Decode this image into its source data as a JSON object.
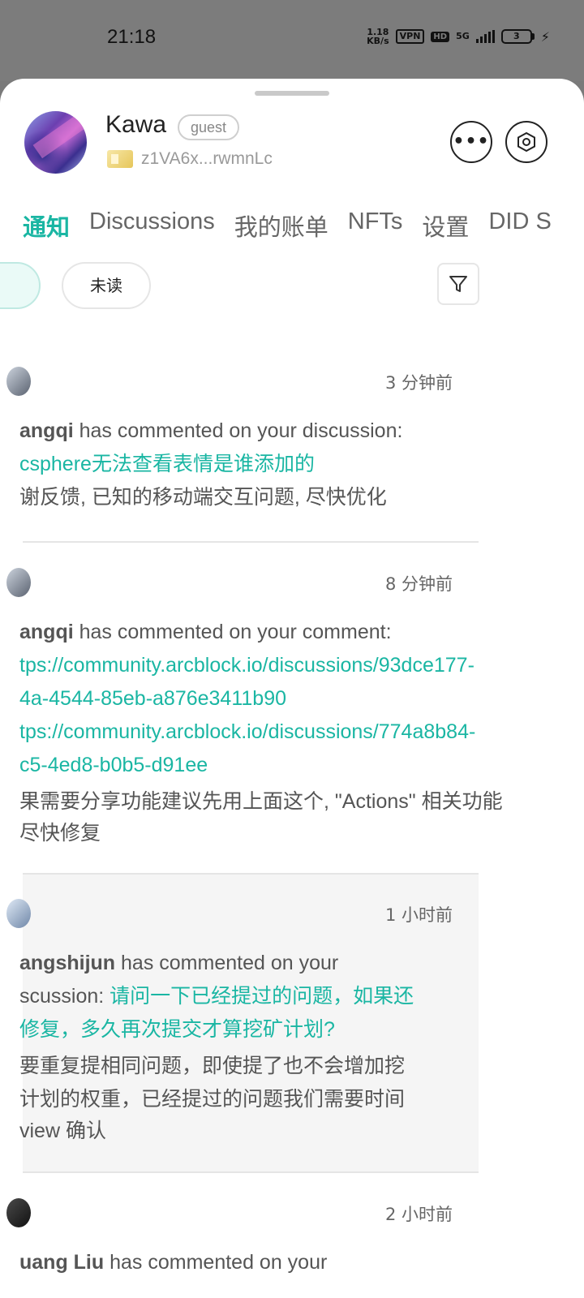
{
  "status_bar": {
    "time": "21:18",
    "net_speed_value": "1.18",
    "net_speed_unit": "KB/s",
    "vpn": "VPN",
    "hd": "HD",
    "network": "5G",
    "battery": "3"
  },
  "profile": {
    "name": "Kawa",
    "role_badge": "guest",
    "did": "z1VA6x...rwmnLc"
  },
  "tabs": [
    "通知",
    "Discussions",
    "我的账单",
    "NFTs",
    "设置",
    "DID S"
  ],
  "filters": {
    "unread_label": "未读"
  },
  "notifications": [
    {
      "time": "3 分钟前",
      "line1_user": "angqi",
      "line1_text": " has commented on your discussion:",
      "line2_link": "csphere无法查看表情是谁添加的",
      "line3": "谢反馈, 已知的移动端交互问题, 尽快优化"
    },
    {
      "time": "8 分钟前",
      "line1_user": "angqi",
      "line1_text": " has commented on your comment:",
      "link1a": "tps://community.arcblock.io/discussions/93dce177-",
      "link1b": "4a-4544-85eb-a876e3411b90",
      "link2a": "tps://community.arcblock.io/discussions/774a8b84-",
      "link2b": "c5-4ed8-b0b5-d91ee",
      "msg1": "果需要分享功能建议先用上面这个, \"Actions\" 相关功能",
      "msg2": "尽快修复"
    },
    {
      "time": "1 小时前",
      "line1_user": "angshijun",
      "line1_text": " has commented on your",
      "line2_text": "scussion: ",
      "line2_link": "请问一下已经提过的问题，如果还",
      "line3_link": "修复，多久再次提交才算挖矿计划?",
      "msg1": "要重复提相同问题，即使提了也不会增加挖",
      "msg2": "计划的权重，已经提过的问题我们需要时间",
      "msg3": "view 确认"
    },
    {
      "time": "2 小时前",
      "line1_user": "uang Liu",
      "line1_text": " has commented on your"
    }
  ]
}
